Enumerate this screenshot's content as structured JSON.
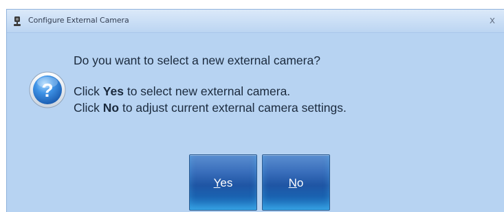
{
  "window": {
    "title": "Configure External Camera",
    "close_glyph": "x"
  },
  "icons": {
    "title_icon": "camera-icon",
    "message_icon": "question-icon"
  },
  "message": {
    "question": "Do you want to select a new external camera?",
    "line2": {
      "prefix": "Click ",
      "keyword": "Yes",
      "suffix": " to select new external camera."
    },
    "line3": {
      "prefix": "Click ",
      "keyword": "No",
      "suffix": " to adjust current external camera settings."
    }
  },
  "buttons": {
    "yes": {
      "mnemonic": "Y",
      "rest": "es"
    },
    "no": {
      "mnemonic": "N",
      "rest": "o"
    }
  },
  "colors": {
    "dialog_background": "#b7d3f2",
    "button_blue": "#1f55a4",
    "icon_blue": "#2e7fd6"
  }
}
